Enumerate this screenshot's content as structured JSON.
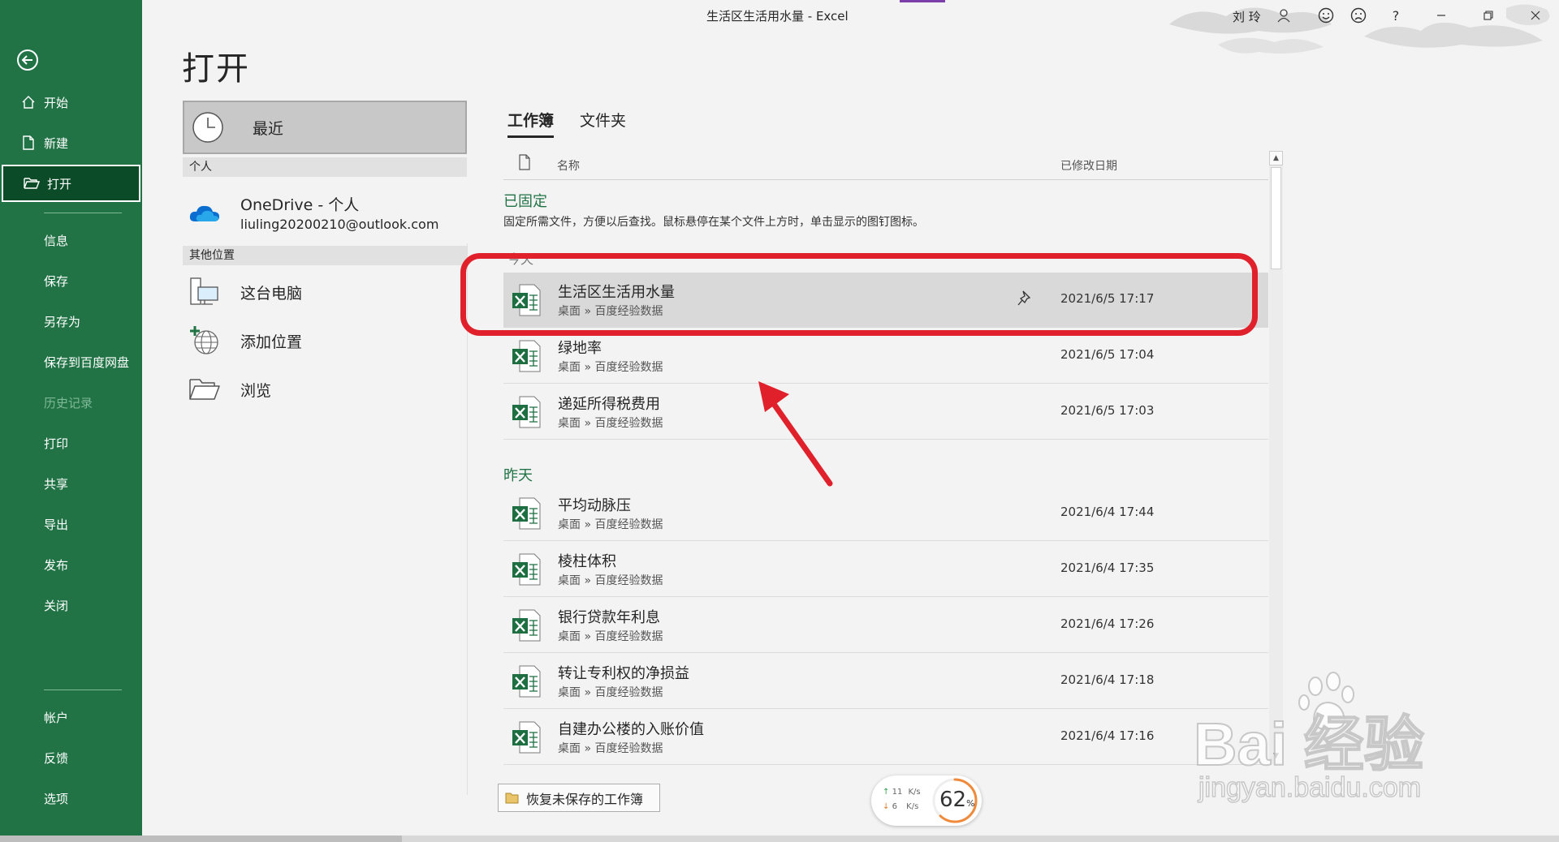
{
  "window": {
    "title": "生活区生活用水量  -  Excel",
    "user": "刘 玲",
    "controls": [
      "smiley-icon",
      "frown-icon",
      "help-icon",
      "minimize-icon",
      "restore-icon",
      "close-icon"
    ],
    "help_label": "?"
  },
  "nav": {
    "items": [
      {
        "label": "开始",
        "icon": "home-icon"
      },
      {
        "label": "新建",
        "icon": "new-document-icon"
      },
      {
        "label": "打开",
        "icon": "open-folder-icon",
        "selected": true
      },
      {
        "label": "信息"
      },
      {
        "label": "保存"
      },
      {
        "label": "另存为"
      },
      {
        "label": "保存到百度网盘"
      },
      {
        "label": "历史记录",
        "disabled": true
      },
      {
        "label": "打印"
      },
      {
        "label": "共享"
      },
      {
        "label": "导出"
      },
      {
        "label": "发布"
      },
      {
        "label": "关闭"
      }
    ],
    "bottom_items": [
      {
        "label": "帐户"
      },
      {
        "label": "反馈"
      },
      {
        "label": "选项"
      }
    ]
  },
  "page": {
    "title": "打开"
  },
  "locations": {
    "recent": "最近",
    "section_personal": "个人",
    "onedrive_title": "OneDrive - 个人",
    "onedrive_account": "liuling20200210@outlook.com",
    "section_other": "其他位置",
    "this_pc": "这台电脑",
    "add_place": "添加位置",
    "browse": "浏览"
  },
  "files": {
    "tabs": [
      "工作簿",
      "文件夹"
    ],
    "col_name": "名称",
    "col_date": "已修改日期",
    "pinned_title": "已固定",
    "pinned_desc": "固定所需文件，方便以后查找。鼠标悬停在某个文件上方时，单击显示的图钉图标。",
    "today_title": "今天",
    "yesterday_title": "昨天",
    "today": [
      {
        "name": "生活区生活用水量",
        "path": "桌面 » 百度经验数据",
        "date": "2021/6/5 17:17",
        "hover": true
      },
      {
        "name": "绿地率",
        "path": "桌面 » 百度经验数据",
        "date": "2021/6/5 17:04"
      },
      {
        "name": "递延所得税费用",
        "path": "桌面 » 百度经验数据",
        "date": "2021/6/5 17:03"
      }
    ],
    "yesterday": [
      {
        "name": "平均动脉压",
        "path": "桌面 » 百度经验数据",
        "date": "2021/6/4 17:44"
      },
      {
        "name": "棱柱体积",
        "path": "桌面 » 百度经验数据",
        "date": "2021/6/4 17:35"
      },
      {
        "name": "银行贷款年利息",
        "path": "桌面 » 百度经验数据",
        "date": "2021/6/4 17:26"
      },
      {
        "name": "转让专利权的净损益",
        "path": "桌面 » 百度经验数据",
        "date": "2021/6/4 17:18"
      },
      {
        "name": "自建办公楼的入账价值",
        "path": "桌面 » 百度经验数据",
        "date": "2021/6/4 17:16"
      }
    ],
    "recover_label": "恢复未保存的工作簿"
  },
  "network": {
    "up": "11",
    "down": "6",
    "unit": "K/s",
    "percent": "62",
    "percent_sign": "%"
  },
  "watermark": {
    "main": "Bai 经验",
    "sub": "jingyan.baidu.com"
  },
  "colors": {
    "nav_green": "#217346",
    "nav_selected": "#0b4b27",
    "highlight_red": "#e0202a",
    "excel_green": "#1d6f42"
  }
}
